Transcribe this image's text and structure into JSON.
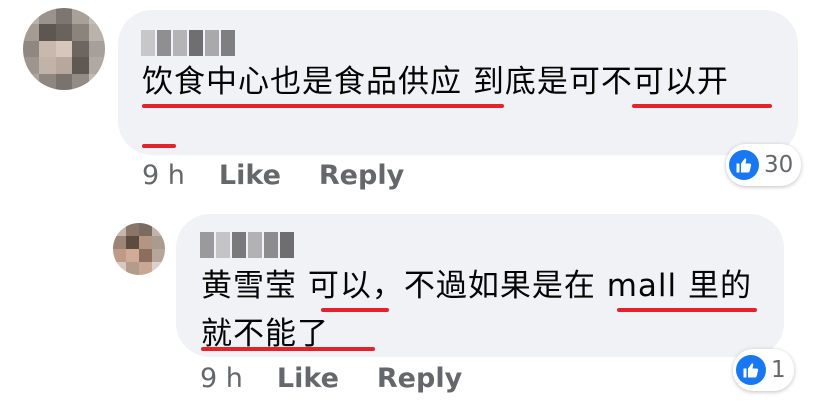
{
  "comments": [
    {
      "author_name_visible": false,
      "text": "饮食中心也是食品供应 到底是可不可以开",
      "time": "9 h",
      "like_label": "Like",
      "reply_label": "Reply",
      "reaction_count": "30",
      "reaction_icon": "thumbs-up-icon"
    },
    {
      "author_name_visible": false,
      "text": "黄雪莹 可以，不過如果是在 mall 里的就不能了",
      "time": "9 h",
      "like_label": "Like",
      "reply_label": "Reply",
      "reaction_count": "1",
      "reaction_icon": "thumbs-up-icon"
    }
  ],
  "colors": {
    "bubble": "#f0f2f5",
    "meta_text": "#65676b",
    "annotation_underline": "#e4222b",
    "like_blue": "#1877f2"
  }
}
